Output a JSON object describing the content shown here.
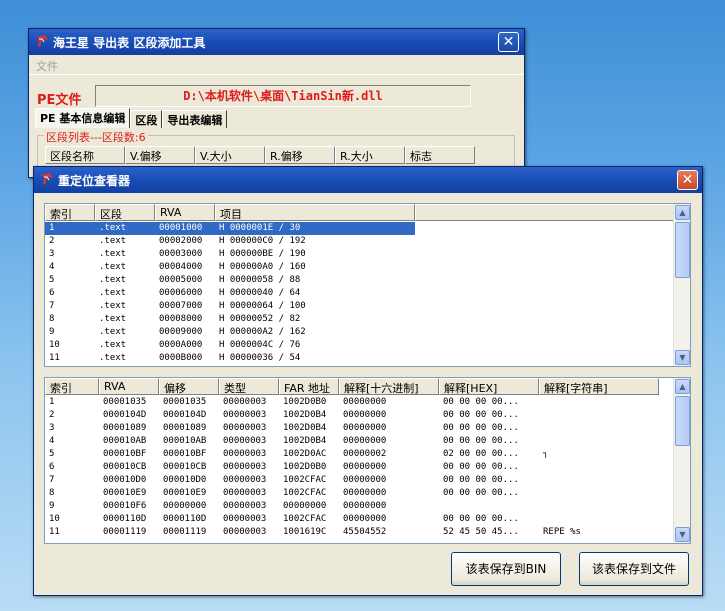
{
  "main_window": {
    "title": "海王星 导出表 区段添加工具",
    "close_symbol": "✕",
    "menu": [
      "文件"
    ],
    "pe_label": "PE文件",
    "pe_path": "D:\\本机软件\\桌面\\TianSin新.dll",
    "tabs": [
      "PE 基本信息编辑",
      "区段",
      "导出表编辑"
    ],
    "section_list_label": "区段列表---区段数:6",
    "section_columns": [
      "区段名称",
      "V.偏移",
      "V.大小",
      "R.偏移",
      "R.大小",
      "标志"
    ]
  },
  "reloc_window": {
    "title": "重定位查看器",
    "close_symbol": "✕",
    "block_columns": [
      "索引",
      "区段",
      "RVA",
      "项目"
    ],
    "block_rows": [
      [
        "1",
        ".text",
        "00001000",
        "H 0000001E / 30"
      ],
      [
        "2",
        ".text",
        "00002000",
        "H 000000C0 / 192"
      ],
      [
        "3",
        ".text",
        "00003000",
        "H 000000BE / 190"
      ],
      [
        "4",
        ".text",
        "00004000",
        "H 000000A0 / 160"
      ],
      [
        "5",
        ".text",
        "00005000",
        "H 00000058 / 88"
      ],
      [
        "6",
        ".text",
        "00006000",
        "H 00000040 / 64"
      ],
      [
        "7",
        ".text",
        "00007000",
        "H 00000064 / 100"
      ],
      [
        "8",
        ".text",
        "00008000",
        "H 00000052 / 82"
      ],
      [
        "9",
        ".text",
        "00009000",
        "H 000000A2 / 162"
      ],
      [
        "10",
        ".text",
        "0000A000",
        "H 0000004C / 76"
      ],
      [
        "11",
        ".text",
        "0000B000",
        "H 00000036 / 54"
      ]
    ],
    "entry_columns": [
      "索引",
      "RVA",
      "偏移",
      "类型",
      "FAR 地址",
      "解释[十六进制]",
      "解释[HEX]",
      "解释[字符串]"
    ],
    "entry_rows": [
      [
        "1",
        "00001035",
        "00001035",
        "00000003",
        "1002D0B0",
        "00000000",
        "00 00 00 00...",
        ""
      ],
      [
        "2",
        "0000104D",
        "0000104D",
        "00000003",
        "1002D0B4",
        "00000000",
        "00 00 00 00...",
        ""
      ],
      [
        "3",
        "00001089",
        "00001089",
        "00000003",
        "1002D0B4",
        "00000000",
        "00 00 00 00...",
        ""
      ],
      [
        "4",
        "000010AB",
        "000010AB",
        "00000003",
        "1002D0B4",
        "00000000",
        "00 00 00 00...",
        ""
      ],
      [
        "5",
        "000010BF",
        "000010BF",
        "00000003",
        "1002D0AC",
        "00000002",
        "02 00 00 00...",
        "┐"
      ],
      [
        "6",
        "000010CB",
        "000010CB",
        "00000003",
        "1002D0B0",
        "00000000",
        "00 00 00 00...",
        ""
      ],
      [
        "7",
        "000010D0",
        "000010D0",
        "00000003",
        "1002CFAC",
        "00000000",
        "00 00 00 00...",
        ""
      ],
      [
        "8",
        "000010E9",
        "000010E9",
        "00000003",
        "1002CFAC",
        "00000000",
        "00 00 00 00...",
        ""
      ],
      [
        "9",
        "000010F6",
        "00000000",
        "00000003",
        "00000000",
        "00000000",
        "",
        ""
      ],
      [
        "10",
        "0000110D",
        "0000110D",
        "00000003",
        "1002CFAC",
        "00000000",
        "00 00 00 00...",
        ""
      ],
      [
        "11",
        "00001119",
        "00001119",
        "00000003",
        "1001619C",
        "45504552",
        "52 45 50 45...",
        "REPE %s"
      ]
    ],
    "buttons": {
      "save_bin": "该表保存到BIN",
      "save_file": "该表保存到文件"
    }
  },
  "colors": {
    "title_bar": "#1a4fb8",
    "accent_red": "#e01b1b",
    "selection": "#316ac5"
  }
}
